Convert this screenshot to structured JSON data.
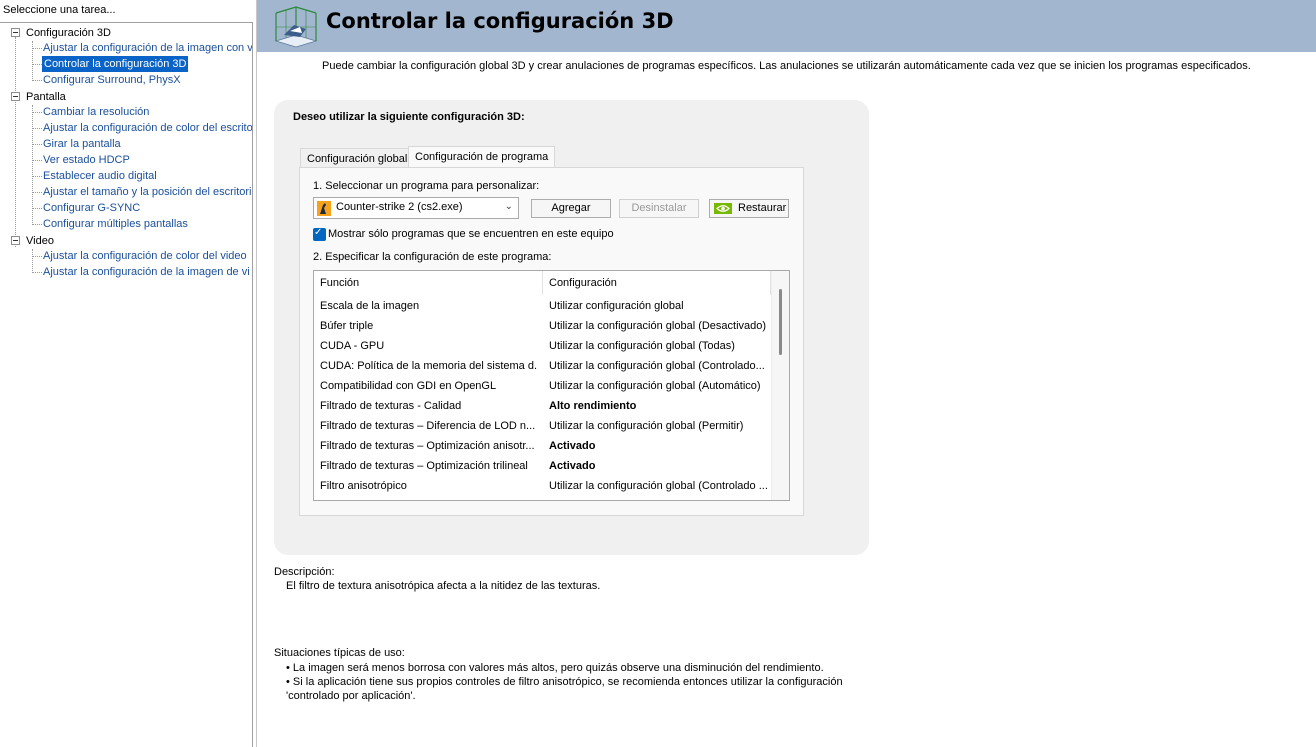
{
  "sidebar": {
    "title": "Seleccione una tarea...",
    "groups": [
      {
        "label": "Configuración 3D",
        "items": [
          "Ajustar la configuración de la imagen con v",
          "Controlar la configuración 3D",
          "Configurar Surround, PhysX"
        ]
      },
      {
        "label": "Pantalla",
        "items": [
          "Cambiar la resolución",
          "Ajustar la configuración de color del escrito",
          "Girar la pantalla",
          "Ver estado HDCP",
          "Establecer audio digital",
          "Ajustar el tamaño y la posición del escritori",
          "Configurar G-SYNC",
          "Configurar múltiples pantallas"
        ]
      },
      {
        "label": "Video",
        "items": [
          "Ajustar la configuración de color del video",
          "Ajustar la configuración de la imagen de vi"
        ]
      }
    ],
    "selected": "Controlar la configuración 3D"
  },
  "header": {
    "title": "Controlar la configuración 3D",
    "intro": "Puede cambiar la configuración global 3D y crear anulaciones de programas específicos. Las anulaciones se utilizarán automáticamente cada vez que se inicien los programas especificados."
  },
  "config": {
    "heading": "Deseo utilizar la siguiente configuración 3D:",
    "tabs": [
      "Configuración global",
      "Configuración de programa"
    ],
    "active_tab": "Configuración de programa",
    "step1": "1. Seleccionar un programa para personalizar:",
    "program": "Counter-strike 2 (cs2.exe)",
    "buttons": {
      "add": "Agregar",
      "uninstall": "Desinstalar",
      "restore": "Restaurar"
    },
    "show_only_checkbox": {
      "label": "Mostrar sólo programas que se encuentren en este equipo",
      "checked": true
    },
    "step2": "2. Especificar la configuración de este programa:",
    "table": {
      "columns": [
        "Función",
        "Configuración"
      ],
      "rows": [
        {
          "feature": "Escala de la imagen",
          "setting": "Utilizar configuración global",
          "bold": false
        },
        {
          "feature": "Búfer triple",
          "setting": "Utilizar la configuración global (Desactivado)",
          "bold": false
        },
        {
          "feature": "CUDA - GPU",
          "setting": "Utilizar la configuración global (Todas)",
          "bold": false
        },
        {
          "feature": "CUDA: Política de la memoria del sistema d...",
          "setting": "Utilizar la configuración global (Controlado...",
          "bold": false
        },
        {
          "feature": "Compatibilidad con GDI en OpenGL",
          "setting": "Utilizar la configuración global (Automático)",
          "bold": false
        },
        {
          "feature": "Filtrado de texturas - Calidad",
          "setting": "Alto rendimiento",
          "bold": true
        },
        {
          "feature": "Filtrado de texturas – Diferencia de LOD n...",
          "setting": "Utilizar la configuración global (Permitir)",
          "bold": false
        },
        {
          "feature": "Filtrado de texturas – Optimización anisotr...",
          "setting": "Activado",
          "bold": true
        },
        {
          "feature": "Filtrado de texturas – Optimización trilineal",
          "setting": "Activado",
          "bold": true
        },
        {
          "feature": "Filtro anisotrópico",
          "setting": "Utilizar la configuración global (Controlado ...",
          "bold": false
        }
      ]
    }
  },
  "description": {
    "label": "Descripción:",
    "text": "El filtro de textura anisotrópica afecta a la nitidez de las texturas."
  },
  "usage": {
    "label": "Situaciones típicas de uso:",
    "bullets": [
      "• La imagen será menos borrosa con valores más altos, pero quizás observe una disminución del rendimiento.",
      "• Si la aplicación tiene sus propios controles de filtro anisotrópico, se recomienda entonces utilizar la configuración",
      "'controlado por aplicación'."
    ]
  },
  "colors": {
    "header_bg": "#a3b6cf",
    "selection": "#0a64c8",
    "link": "#1a4f9c",
    "checkbox": "#0067c0",
    "panel_bg": "#f0f0f0"
  },
  "icons": {
    "header": "3d-cube-icon",
    "program": "counter-strike-icon",
    "restore": "nvidia-logo-icon"
  }
}
